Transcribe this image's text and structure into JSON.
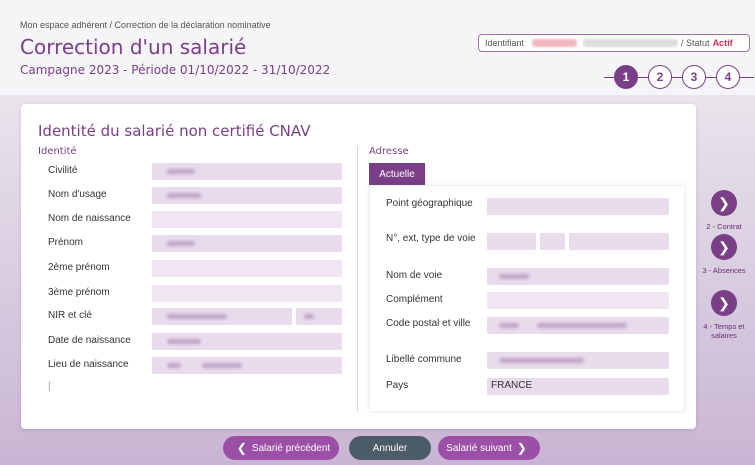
{
  "breadcrumb": "Mon espace adhérent / Correction de la déclaration nominative",
  "title": "Correction d'un salarié",
  "campaign": "Campagne 2023 - Période 01/10/2022 - 31/10/2022",
  "id_box": {
    "identifiant_label": "Identifiant",
    "statut_label": "/ Statut",
    "statut_value": "Actif"
  },
  "stepper": {
    "steps": [
      "1",
      "2",
      "3",
      "4"
    ],
    "active": "1"
  },
  "card": {
    "title": "Identité du salarié non certifié CNAV",
    "identite": {
      "title": "Identité",
      "fields": [
        "Civilité",
        "Nom d'usage",
        "Nom de naissance",
        "Prénom",
        "2ème prénom",
        "3ème prénom",
        "NIR et clé",
        "Date de naissance",
        "Lieu de naissance"
      ],
      "extra": "|"
    },
    "adresse": {
      "title": "Adresse",
      "tab": "Actuelle",
      "fields": [
        "Point géographique",
        "N°, ext, type de voie",
        "Nom de voie",
        "Complément",
        "Code postal et ville",
        "Libellé commune",
        "Pays"
      ],
      "pays_value": "FRANCE"
    }
  },
  "side_nav": [
    {
      "label": "2 - Contrat",
      "icon": "chevron-right-icon"
    },
    {
      "label": "3 - Absences",
      "icon": "chevron-right-icon"
    },
    {
      "label": "4 - Temps et salaires",
      "icon": "chevron-right-icon"
    }
  ],
  "buttons": {
    "prev": "Salarié précédent",
    "cancel": "Annuler",
    "next": "Salarié suivant"
  },
  "colors": {
    "primary": "#7a3f86",
    "accent_red": "#c7314d",
    "field_bg": "#e8dcec"
  }
}
